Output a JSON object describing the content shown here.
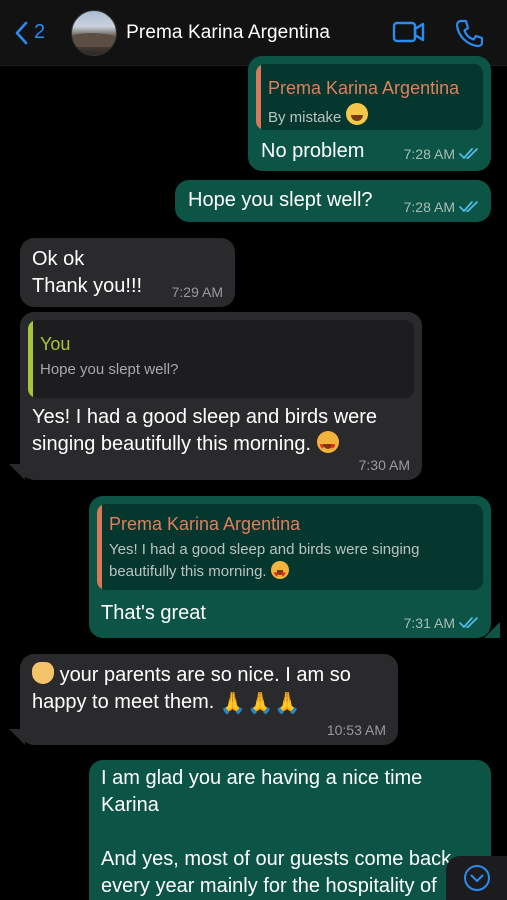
{
  "header": {
    "back_count": "2",
    "contact_name": "Prema Karina Argentina",
    "accent_color": "#2a8cf0"
  },
  "messages": [
    {
      "direction": "out",
      "quote_name": "Prema Karina Argentina",
      "quote_text": "By mistake",
      "quote_emoji": "rolling-laugh",
      "text": "No problem",
      "time": "7:28 AM",
      "status": "read"
    },
    {
      "direction": "out",
      "text": "Hope you slept well?",
      "time": "7:28 AM",
      "status": "read"
    },
    {
      "direction": "in",
      "text_line1": "Ok ok",
      "text_line2": "Thank you!!!",
      "time": "7:29 AM"
    },
    {
      "direction": "in",
      "quote_name": "You",
      "quote_text": "Hope you slept well?",
      "text_line1": "Yes! I had a good sleep and birds were",
      "text_line2": "singing beautifully this morning.",
      "emoji": "heart-eyes",
      "time": "7:30 AM"
    },
    {
      "direction": "out",
      "quote_name": "Prema Karina Argentina",
      "quote_text_line1": "Yes! I had a good sleep and birds were singing",
      "quote_text_line2": "beautifully this morning.",
      "quote_emoji": "heart-eyes",
      "text": "That's great",
      "time": "7:31 AM",
      "status": "read"
    },
    {
      "direction": "in",
      "emoji": "ok-hand",
      "text_line1": "your parents are so nice. I am so",
      "text_line2": "happy to meet them.",
      "trailing_emoji": "folded-hands x3",
      "time": "10:53 AM"
    },
    {
      "direction": "out",
      "text_line1": "I am glad you are having a nice time",
      "text_line2": "Karina",
      "text_line3": "And yes, most of our guests come back",
      "text_line4": "every year mainly for the hospitality of"
    }
  ],
  "colors": {
    "outgoing_bubble": "#0c5445",
    "incoming_bubble": "#2a2a2c",
    "read_ticks": "#53bdeb"
  }
}
